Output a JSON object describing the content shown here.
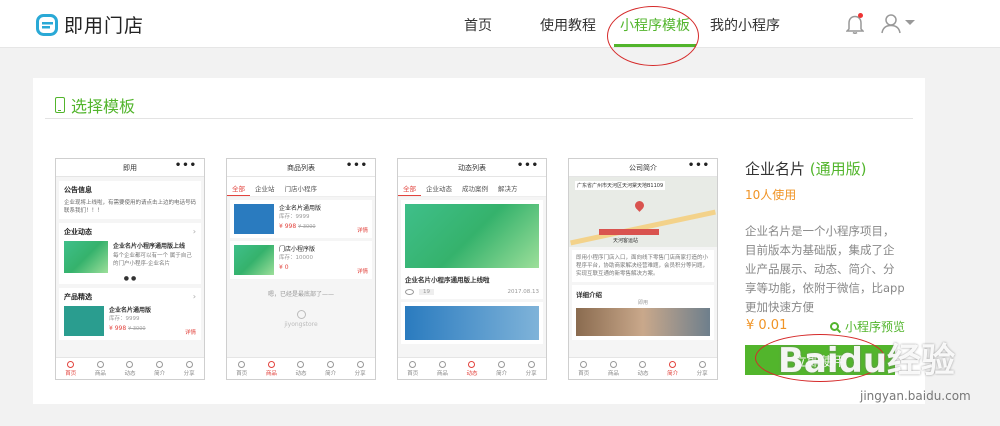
{
  "brand": {
    "name": "即用门店"
  },
  "nav": {
    "items": [
      {
        "label": "首页",
        "active": false
      },
      {
        "label": "使用教程",
        "active": false
      },
      {
        "label": "小程序模板",
        "active": true
      },
      {
        "label": "我的小程序",
        "active": false
      }
    ]
  },
  "panel": {
    "title": "选择模板"
  },
  "templates": [
    {
      "header": "即用",
      "sections": [
        {
          "heading": "公告信息",
          "text": "企业现将上线啦，有需要使用的请点击上边的电话号码联系我们！！！"
        },
        {
          "heading": "企业动态",
          "item_title": "企业名片小程序通用版上线",
          "item_text": "每个企业都可以有一个 属于自己的门户小程序-企业名片"
        },
        {
          "heading": "产品精选",
          "item_title": "企业名片通用版",
          "stock": "库存：9999",
          "price": "¥ 998",
          "old_price": "¥ 3000",
          "tag": "详情"
        }
      ],
      "footer": [
        "首页",
        "商品",
        "动态",
        "简介",
        "分享"
      ],
      "active_footer": 0
    },
    {
      "header": "商品列表",
      "tabs": [
        "全部",
        "企业站",
        "门店小程序"
      ],
      "products": [
        {
          "title": "企业名片通用版",
          "stock": "库存：9999",
          "price": "¥ 998",
          "old_price": "¥ 3000",
          "tag": "详情"
        },
        {
          "title": "门店小程序版",
          "stock": "库存：10000",
          "price": "¥ 0",
          "tag": "详情"
        }
      ],
      "end_text": "嗯，已经是最底部了——",
      "footer_brand": "jiyongstore",
      "footer": [
        "首页",
        "商品",
        "动态",
        "简介",
        "分享"
      ],
      "active_footer": 1
    },
    {
      "header": "动态列表",
      "tabs": [
        "全部",
        "企业动态",
        "成功案例",
        "解决方"
      ],
      "article": {
        "title": "企业名片小程序通用版上线啦",
        "views": "19",
        "date": "2017.08.13"
      },
      "footer": [
        "首页",
        "商品",
        "动态",
        "简介",
        "分享"
      ],
      "active_footer": 2
    },
    {
      "header": "公司简介",
      "map_address": "广东省广州市天河区天河棠天地B1109",
      "map_label": "天河客运站",
      "intro_text": "即用小程序门店入口，面向线下零售门店商家打造的小程序平台，协助商家解决经营难题，会员积分等问题，实现互联互通的新零售解决方案。",
      "detail_heading": "详细介绍",
      "detail_sub": "即用",
      "footer": [
        "首页",
        "商品",
        "动态",
        "简介",
        "分享"
      ],
      "active_footer": 3
    }
  ],
  "selected": {
    "name": "企业名片",
    "version": "(通用版)",
    "users": "10人使用",
    "description": "企业名片是一个小程序项目，目前版本为基础版，集成了企业产品展示、动态、简介、分享等功能，依附于微信，比app更加快速方便",
    "price": "¥ 0.01",
    "preview_label": "小程序预览",
    "use_label": "立即使用"
  },
  "watermark": {
    "main": "Baidu经验",
    "sub": "jingyan.baidu.com"
  },
  "colors": {
    "accent": "#52b52c",
    "price": "#f09426",
    "highlight_circle": "#d52a2a"
  }
}
